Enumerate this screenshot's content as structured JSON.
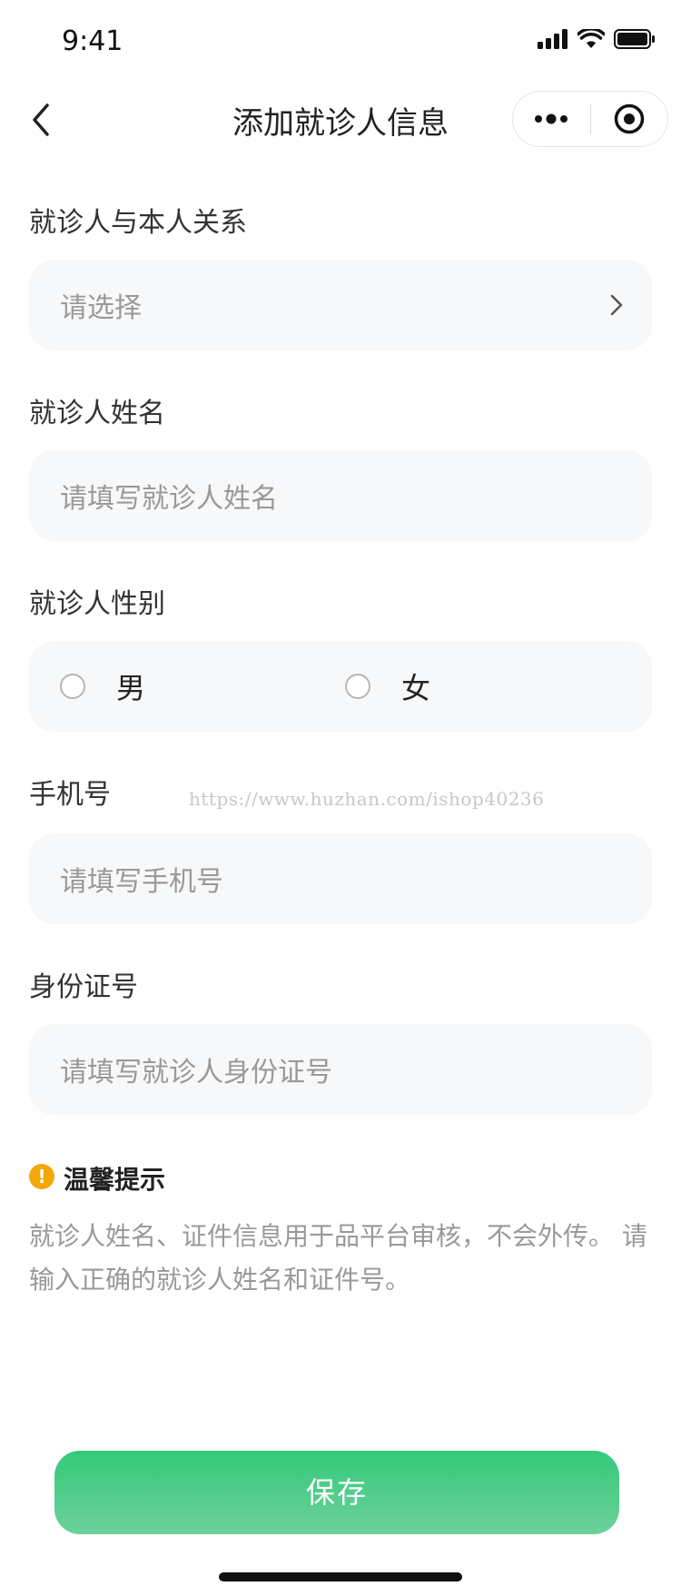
{
  "status_bar": {
    "time": "9:41"
  },
  "nav": {
    "title": "添加就诊人信息"
  },
  "form": {
    "relation": {
      "label": "就诊人与本人关系",
      "placeholder": "请选择"
    },
    "name": {
      "label": "就诊人姓名",
      "placeholder": "请填写就诊人姓名"
    },
    "gender": {
      "label": "就诊人性别",
      "options": [
        "男",
        "女"
      ]
    },
    "phone": {
      "label": "手机号",
      "placeholder": "请填写手机号"
    },
    "id_number": {
      "label": "身份证号",
      "placeholder": "请填写就诊人身份证号"
    }
  },
  "watermark": "https://www.huzhan.com/ishop40236",
  "tip": {
    "title": "温馨提示",
    "body": "就诊人姓名、证件信息用于品平台审核，不会外传。 请输入正确的就诊人姓名和证件号。"
  },
  "save_label": "保存",
  "colors": {
    "accent": "#34c97a",
    "warning": "#f5a70a",
    "field_bg": "#f7f8fa"
  }
}
